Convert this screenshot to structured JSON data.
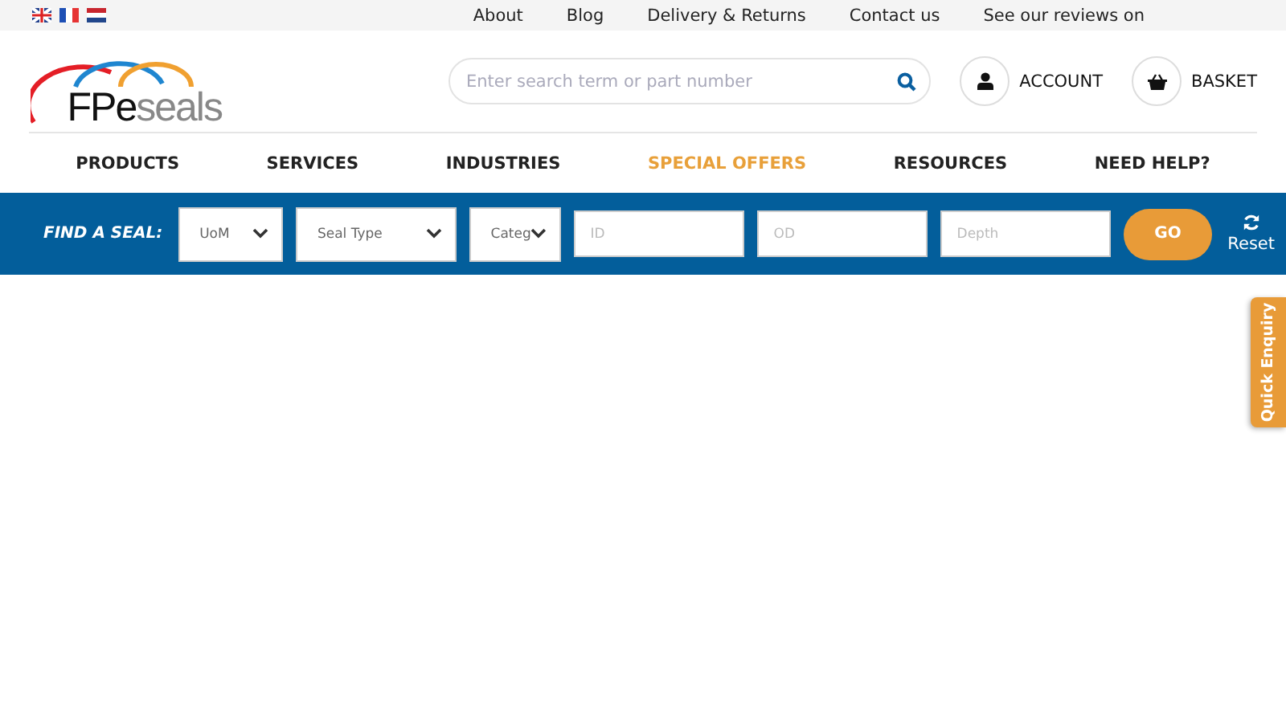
{
  "languages": [
    {
      "kind": "uk"
    },
    {
      "kind": "fr"
    },
    {
      "kind": "nl"
    }
  ],
  "top_links": [
    "About",
    "Blog",
    "Delivery & Returns",
    "Contact us",
    "See our reviews on"
  ],
  "logo": {
    "dark": "FPe",
    "light": "seals"
  },
  "search": {
    "placeholder": "Enter search term or part number"
  },
  "account": "ACCOUNT",
  "basket": "BASKET",
  "nav": [
    {
      "label": "PRODUCTS",
      "highlighted": false
    },
    {
      "label": "SERVICES",
      "highlighted": false
    },
    {
      "label": "INDUSTRIES",
      "highlighted": false
    },
    {
      "label": "SPECIAL OFFERS",
      "highlighted": true
    },
    {
      "label": "RESOURCES",
      "highlighted": false
    },
    {
      "label": "NEED HELP?",
      "highlighted": false
    }
  ],
  "finder": {
    "label": "FIND A SEAL:",
    "selects": [
      {
        "value": "UoM"
      },
      {
        "value": "Seal Type"
      },
      {
        "value": "Categ"
      }
    ],
    "inputs": [
      {
        "placeholder": "ID"
      },
      {
        "placeholder": "OD"
      },
      {
        "placeholder": "Depth"
      }
    ],
    "go": "GO",
    "reset": "Reset"
  },
  "quick_enquiry": "Quick Enquiry"
}
